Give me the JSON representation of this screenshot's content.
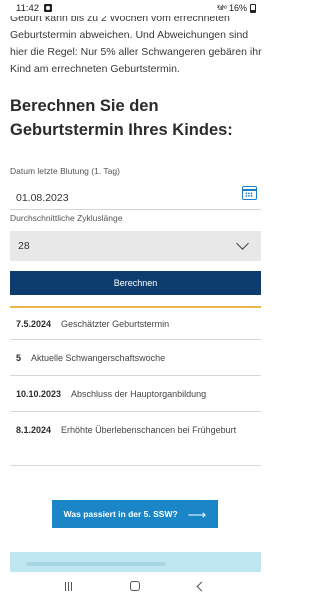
{
  "status_bar": {
    "time": "11:42",
    "signal": "³ᵍ.ıl ᵛᵒ",
    "battery": "16%"
  },
  "intro_text": "Geburt kann bis zu 2 Wochen vom errechneten Geburtstermin abweichen. Und Abweichungen sind hier die Regel: Nur 5% aller Schwangeren gebären ihr Kind am errechneten Geburtstermin.",
  "heading": "Berechnen Sie den Geburtstermin Ihres Kindes:",
  "form": {
    "date_label": "Datum letzte Blutung (1. Tag)",
    "date_value": "01.08.2023",
    "cycle_label": "Durchschnittliche Zykluslänge",
    "cycle_value": "28",
    "calculate_label": "Berechnen"
  },
  "results": [
    {
      "key": "7.5.2024",
      "text": "Geschätzter Geburtstermin"
    },
    {
      "key": "5",
      "text": "Aktuelle Schwangerschaftswoche"
    },
    {
      "key": "10.10.2023",
      "text": "Abschluss der Hauptorganbildung"
    },
    {
      "key": "8.1.2024",
      "text": "Erhöhte Überlebenschancen bei Frühgeburt"
    }
  ],
  "ssw_button_label": "Was passiert in der 5. SSW?",
  "ssw_button_arrow": "⟶",
  "colors": {
    "primary_dark": "#0d3d6e",
    "accent_blue": "#1a86c8",
    "divider_gold": "#e8b84a",
    "banner_teal": "#bfe7f2"
  }
}
